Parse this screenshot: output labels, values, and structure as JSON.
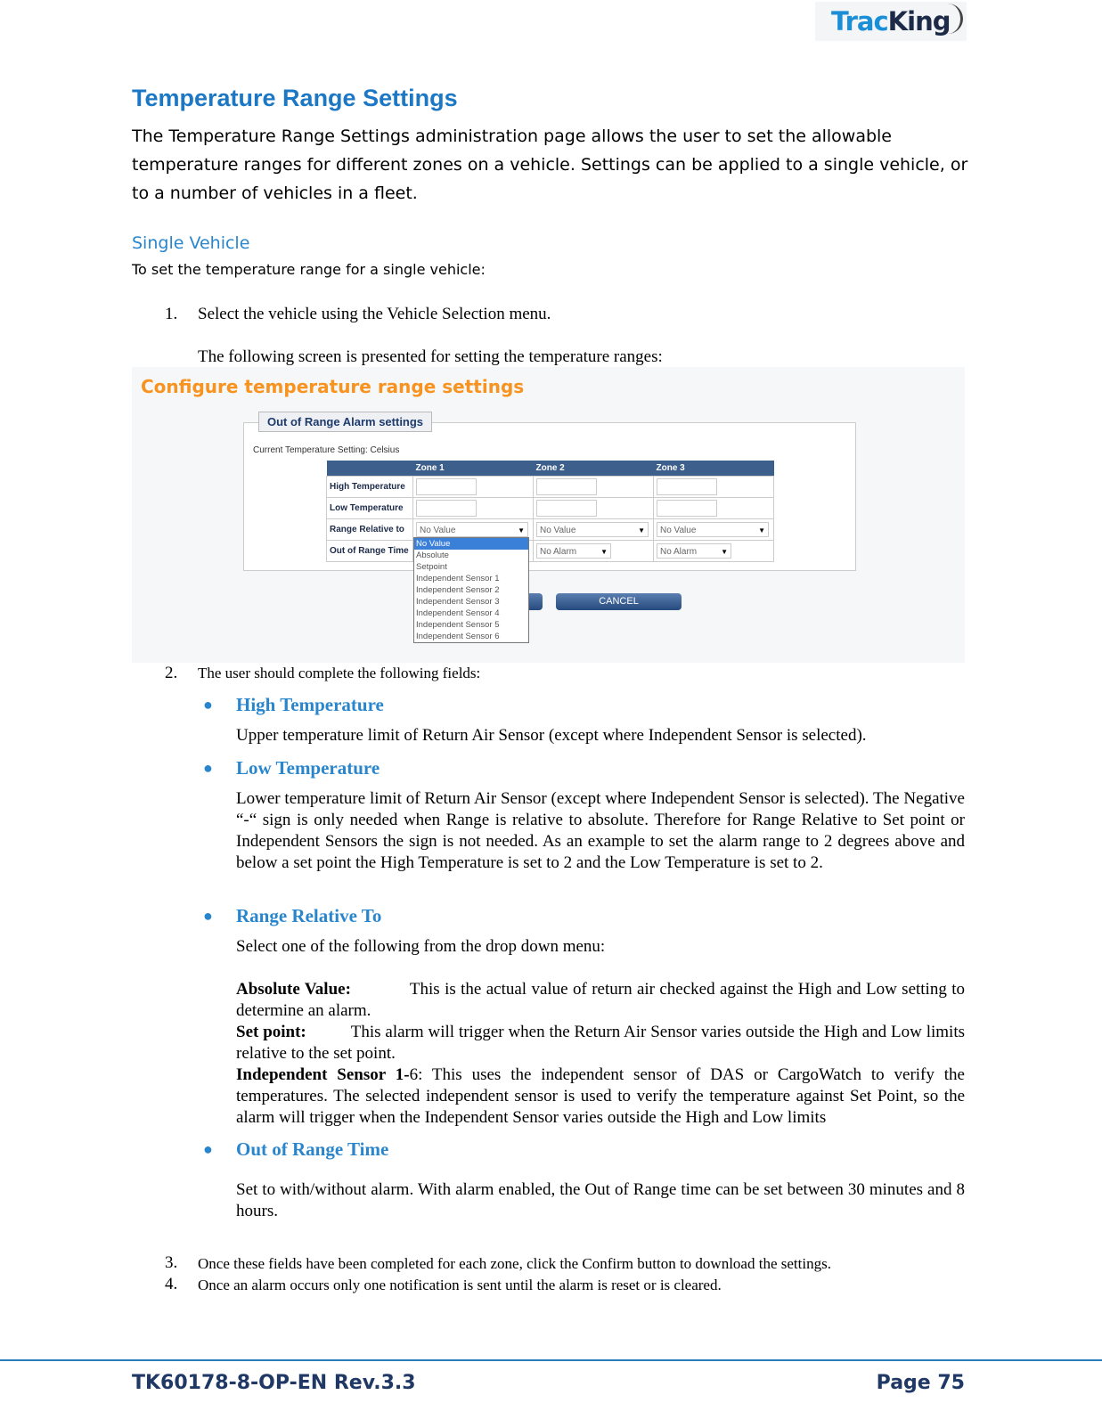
{
  "logo": {
    "text_a": "Trac",
    "text_b": "King"
  },
  "title": "Temperature Range Settings",
  "intro": "The Temperature Range Settings administration page allows the user to set the allowable temperature ranges for different zones on a vehicle. Settings can be applied to a single vehicle, or to a number of vehicles in a fleet.",
  "single_vehicle": {
    "heading": "Single Vehicle",
    "lead": "To set the temperature range for a single vehicle:"
  },
  "steps": [
    {
      "num": "1.",
      "text": "Select the vehicle using the Vehicle Selection menu."
    },
    {
      "num": "2.",
      "text": "The user should complete the following fields:"
    },
    {
      "num": "3.",
      "text": "Once these fields have been completed for each zone, click the Confirm button to download the settings."
    },
    {
      "num": "4.",
      "text": "Once an alarm occurs only one notification is sent until the alarm is reset or is cleared."
    }
  ],
  "step1_note": "The following screen is presented for setting the temperature ranges:",
  "screenshot": {
    "title": "Configure temperature range settings",
    "legend": "Out of Range Alarm settings",
    "current_setting": "Current Temperature Setting:  Celsius",
    "columns": [
      "",
      "Zone 1",
      "Zone 2",
      "Zone 3"
    ],
    "rows": [
      "High Temperature",
      "Low Temperature",
      "Range Relative to",
      "Out of Range Time"
    ],
    "range_value": "No Value",
    "time_value": "No Alarm",
    "dropdown_options": [
      "No Value",
      "Absolute",
      "Setpoint",
      "Independent Sensor 1",
      "Independent Sensor 2",
      "Independent Sensor 3",
      "Independent Sensor 4",
      "Independent Sensor 5",
      "Independent Sensor 6"
    ],
    "cancel": "CANCEL"
  },
  "fields": [
    {
      "title": "High Temperature",
      "desc": "Upper temperature limit of Return Air Sensor (except where Independent Sensor is selected)."
    },
    {
      "title": "Low Temperature",
      "desc": "Lower temperature limit of Return Air Sensor (except where Independent Sensor is selected). The Negative “-“ sign is only needed when Range is relative to absolute. Therefore for Range Relative to Set point or Independent Sensors the sign is not needed. As an example to set the alarm range to 2 degrees above and below a set point the High Temperature is set to 2 and the Low Temperature is set to 2."
    },
    {
      "title": "Range Relative To",
      "desc": "Select one of the following from the drop down menu:"
    },
    {
      "title": "Out of Range Time",
      "desc": "Set to with/without alarm. With alarm enabled, the Out of Range time can be set between 30 minutes and 8 hours."
    }
  ],
  "range_options": [
    {
      "label": "Absolute Value:",
      "text": "This is the actual value of return air checked against the High and Low setting to determine an alarm."
    },
    {
      "label": "Set point:",
      "text": "This alarm will trigger when the Return Air Sensor varies outside the High and Low limits relative to the set point."
    },
    {
      "label": "Independent Sensor 1-",
      "text": "6: This uses the independent sensor of DAS or CargoWatch to verify the temperatures. The selected independent sensor is used to verify the temperature against Set Point, so the alarm will trigger when the Independent Sensor varies outside the High and Low limits"
    }
  ],
  "footer": {
    "doc": "TK60178-8-OP-EN Rev.3.3",
    "page": "Page  75"
  },
  "colors": {
    "heading": "#1c78c4",
    "subheading": "#2a86cc",
    "accent": "#f7931e",
    "footer": "#1f3866"
  }
}
